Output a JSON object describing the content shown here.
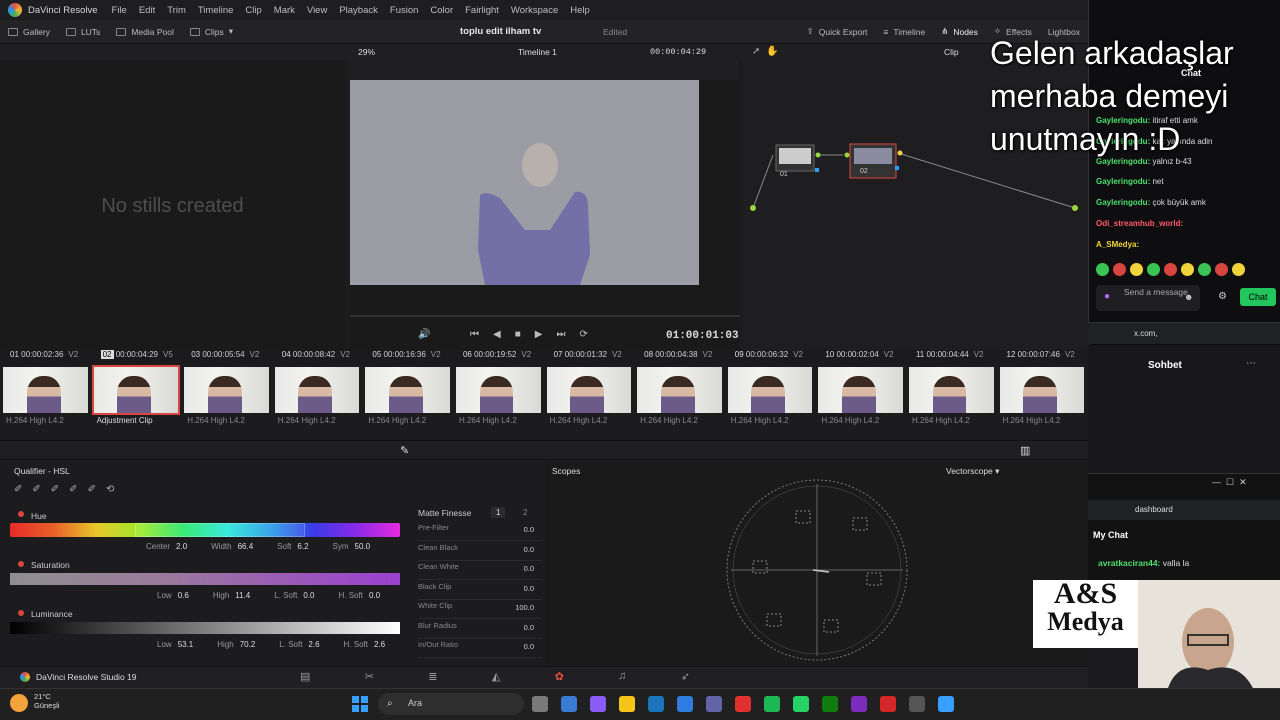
{
  "app": {
    "name": "DaVinci Resolve",
    "menus": [
      "File",
      "Edit",
      "Trim",
      "Timeline",
      "Clip",
      "Mark",
      "View",
      "Playback",
      "Fusion",
      "Color",
      "Fairlight",
      "Workspace",
      "Help"
    ]
  },
  "toolbar": {
    "gallery": "Gallery",
    "luts": "LUTs",
    "media_pool": "Media Pool",
    "clips": "Clips",
    "project_title": "toplu edit ilham tv",
    "project_status": "Edited",
    "quick_export": "Quick Export",
    "timeline": "Timeline",
    "nodes": "Nodes",
    "effects": "Effects",
    "lightbox": "Lightbox"
  },
  "viewer": {
    "zoom": "29%",
    "timeline_name": "Timeline 1",
    "timecode_top": "00:00:04:29",
    "timecode": "01:00:01:03",
    "clip_label": "Clip"
  },
  "gallery": {
    "empty_text": "No stills created"
  },
  "nodes": [
    {
      "label": "01"
    },
    {
      "label": "02"
    }
  ],
  "clips": [
    {
      "num": "01",
      "tc": "00:00:02:36",
      "track": "V2",
      "codec": "H.264 High L4.2"
    },
    {
      "num": "02",
      "tc": "00:00:04:29",
      "track": "V5",
      "codec": "Adjustment Clip",
      "selected": true
    },
    {
      "num": "03",
      "tc": "00:00:05:54",
      "track": "V2",
      "codec": "H.264 High L4.2"
    },
    {
      "num": "04",
      "tc": "00:00:08:42",
      "track": "V2",
      "codec": "H.264 High L4.2"
    },
    {
      "num": "05",
      "tc": "00:00:16:36",
      "track": "V2",
      "codec": "H.264 High L4.2"
    },
    {
      "num": "06",
      "tc": "00:00:19:52",
      "track": "V2",
      "codec": "H.264 High L4.2"
    },
    {
      "num": "07",
      "tc": "00:00:01:32",
      "track": "V2",
      "codec": "H.264 High L4.2"
    },
    {
      "num": "08",
      "tc": "00:00:04:38",
      "track": "V2",
      "codec": "H.264 High L4.2"
    },
    {
      "num": "09",
      "tc": "00:00:06:32",
      "track": "V2",
      "codec": "H.264 High L4.2"
    },
    {
      "num": "10",
      "tc": "00:00:02:04",
      "track": "V2",
      "codec": "H.264 High L4.2"
    },
    {
      "num": "11",
      "tc": "00:00:04:44",
      "track": "V2",
      "codec": "H.264 High L4.2"
    },
    {
      "num": "12",
      "tc": "00:00:07:46",
      "track": "V2",
      "codec": "H.264 High L4.2"
    }
  ],
  "qualifier": {
    "title": "Qualifier - HSL",
    "hue": {
      "label": "Hue",
      "center_lbl": "Center",
      "center": "2.0",
      "width_lbl": "Width",
      "width": "66.4",
      "soft_lbl": "Soft",
      "soft": "6.2",
      "sym_lbl": "Sym",
      "sym": "50.0"
    },
    "saturation": {
      "label": "Saturation",
      "low_lbl": "Low",
      "low": "0.6",
      "high_lbl": "High",
      "high": "11.4",
      "lsoft_lbl": "L. Soft",
      "lsoft": "0.0",
      "hsoft_lbl": "H. Soft",
      "hsoft": "0.0"
    },
    "luminance": {
      "label": "Luminance",
      "low_lbl": "Low",
      "low": "53.1",
      "high_lbl": "High",
      "high": "70.2",
      "lsoft_lbl": "L. Soft",
      "lsoft": "2.6",
      "hsoft_lbl": "H. Soft",
      "hsoft": "2.6"
    }
  },
  "matte": {
    "title": "Matte Finesse",
    "tab1": "1",
    "tab2": "2",
    "rows": [
      {
        "label": "Pre-Filter",
        "value": "0.0"
      },
      {
        "label": "Clean Black",
        "value": "0.0"
      },
      {
        "label": "Clean White",
        "value": "0.0"
      },
      {
        "label": "Black Clip",
        "value": "0.0"
      },
      {
        "label": "White Clip",
        "value": "100.0"
      },
      {
        "label": "Blur Radius",
        "value": "0.0"
      },
      {
        "label": "In/Out Ratio",
        "value": "0.0"
      }
    ]
  },
  "scopes": {
    "title": "Scopes",
    "mode": "Vectorscope"
  },
  "bottom": {
    "product": "DaVinci Resolve Studio 19"
  },
  "taskbar": {
    "temp": "21°C",
    "weather": "Güneşli",
    "search": "Ara"
  },
  "overlay": {
    "text": "Gelen arkadaşlar merhaba demeyi unutmayın :D"
  },
  "chat": {
    "title": "Chat",
    "messages": [
      {
        "user": "Gayleringodu:",
        "text": "itiraf etti amk"
      },
      {
        "user": "Gayleringodu:",
        "text": "kaç yaşında adin"
      },
      {
        "user": "Gayleringodu:",
        "text": "yalnız b-43"
      },
      {
        "user": "Gayleringodu:",
        "text": "net"
      },
      {
        "user": "Gayleringodu:",
        "text": "çok büyük amk"
      },
      {
        "user": "Odi_streamhub_world:",
        "text": ""
      },
      {
        "user": "A_SMedya:",
        "text": ""
      }
    ],
    "send_placeholder": "Send a message",
    "chat_button": "Chat",
    "url": "x.com,",
    "sohbet": "Sohbet"
  },
  "mychat": {
    "url": "dashboard",
    "title": "My Chat",
    "messages": [
      {
        "user": "avratkaciran44:",
        "text": "valla la"
      }
    ]
  },
  "logo": {
    "line1": "A&S",
    "line2": "Medya"
  }
}
